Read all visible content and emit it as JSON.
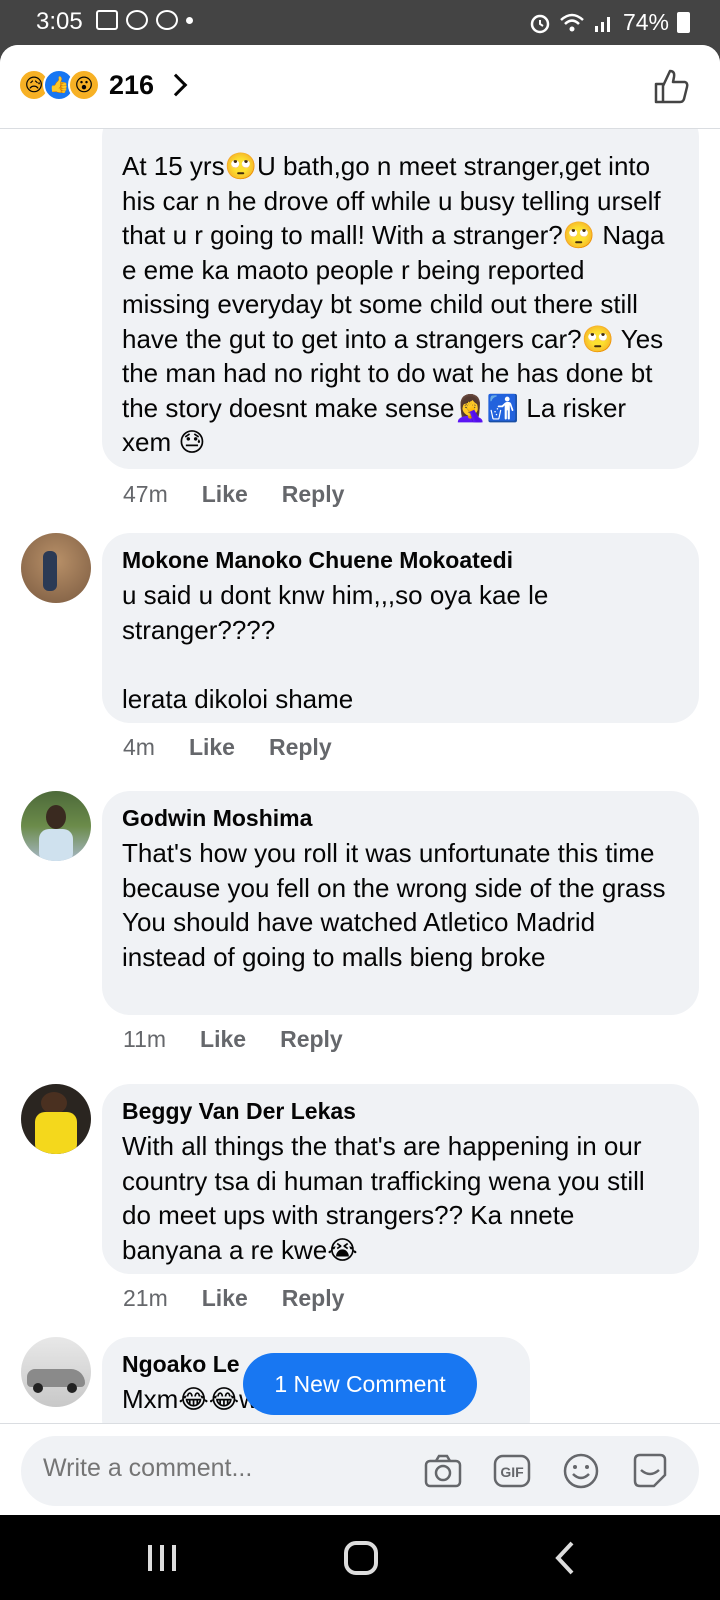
{
  "status_bar": {
    "time": "3:05",
    "battery": "74%"
  },
  "header": {
    "reaction_count": "216",
    "reactions": [
      "sad",
      "like",
      "wow"
    ]
  },
  "comments": [
    {
      "author": "",
      "text": "At 15 yrs🙄U bath,go n meet stranger,get into his car n he drove off while u busy telling urself that u r going to mall! With a stranger?🙄 Naga e eme ka maoto people r being reported missing everyday bt some child out there still have the gut to get into a strangers car?🙄 Yes the man had no right to do wat he has done bt the story doesnt make sense🤦‍♀️🚮 La risker xem 😓",
      "time": "47m",
      "like": "Like",
      "reply": "Reply"
    },
    {
      "author": "Mokone Manoko Chuene Mokoatedi",
      "text": "u said u dont knw him,,,so oya kae le stranger????\n\nlerata dikoloi shame",
      "time": "4m",
      "like": "Like",
      "reply": "Reply"
    },
    {
      "author": "Godwin Moshima",
      "text": "That's how you roll it was unfortunate this time because you fell on the wrong side of the grass\nYou should have watched Atletico Madrid instead of going to malls bieng broke",
      "time": "11m",
      "like": "Like",
      "reply": "Reply"
    },
    {
      "author": "Beggy Van Der Lekas",
      "text": "With all things the that's are happening in our country tsa di human trafficking wena you still do meet ups with strangers?? Ka nnete banyana a re kwe😭",
      "time": "21m",
      "like": "Like",
      "reply": "Reply"
    },
    {
      "author": "Ngoako Le",
      "text": "Mxm😂😂what a lame excuse",
      "time": "",
      "like": "",
      "reply": ""
    }
  ],
  "new_comment_pill": "1 New Comment",
  "composer": {
    "placeholder": "Write a comment...",
    "icons": [
      "camera-icon",
      "gif-icon",
      "emoji-icon",
      "sticker-icon"
    ]
  },
  "colors": {
    "accent": "#1877f2",
    "bubble": "#f0f2f5",
    "meta": "#65676b"
  }
}
